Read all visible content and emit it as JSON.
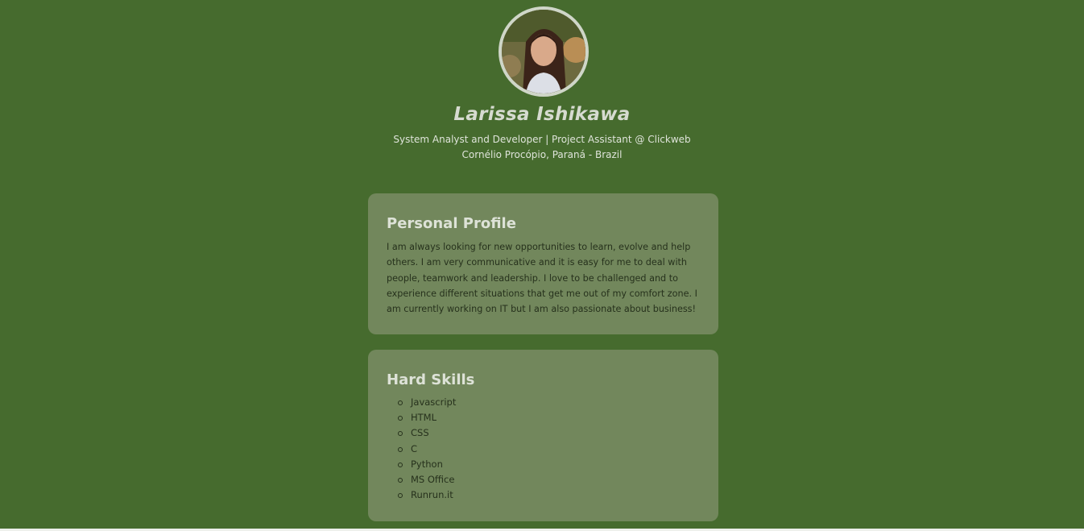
{
  "header": {
    "avatar_icon": "profile-photo",
    "name": "Larissa Ishikawa",
    "headline": "System Analyst and Developer | Project Assistant @ Clickweb",
    "location": "Cornélio Procópio, Paraná - Brazil"
  },
  "profile": {
    "title": "Personal Profile",
    "text": "I am always looking for new opportunities to learn, evolve and help others. I am very communicative and it is easy for me to deal with people, teamwork and leadership. I love to be challenged and to experience different situations that get me out of my comfort zone. I am currently working on IT but I am also passionate about business!"
  },
  "skills": {
    "title": "Hard Skills",
    "items": [
      "Javascript",
      "HTML",
      "CSS",
      "C",
      "Python",
      "MS Office",
      "Runrun.it"
    ]
  },
  "colors": {
    "background": "#466b2e",
    "card": "#72875c",
    "heading_text": "#dde2d7",
    "body_text": "#26311c"
  }
}
